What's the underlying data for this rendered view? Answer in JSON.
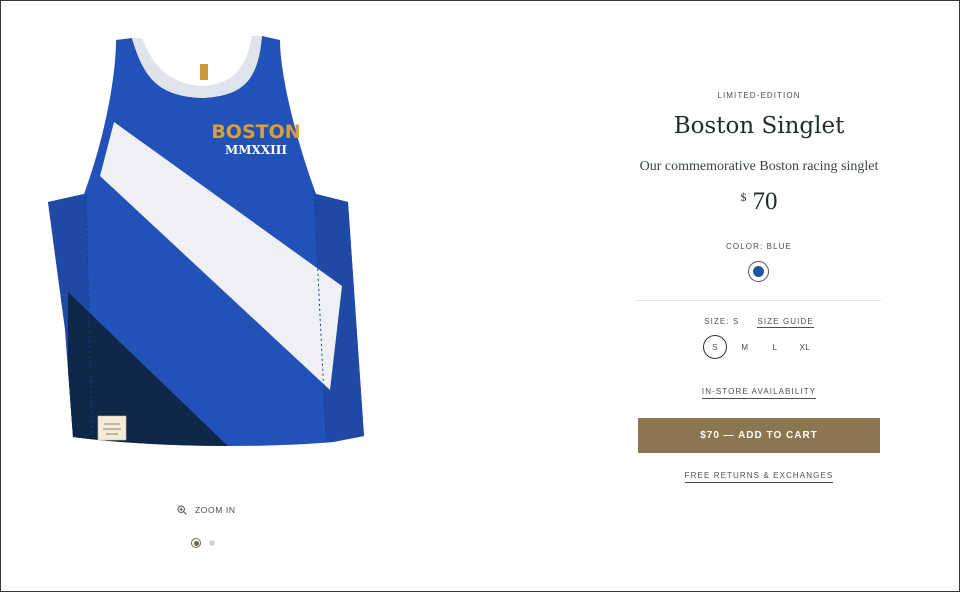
{
  "colors": {
    "accent": "#8b7651",
    "swatch_blue": "#1e56a0",
    "text": "#1e2d2b"
  },
  "gallery": {
    "image_alt": "Boston Singlet in blue",
    "print": {
      "line1": "BOSTON",
      "line2": "MMXXIII"
    },
    "zoom_icon": "zoom-in-icon",
    "zoom_label": "ZOOM IN",
    "slide_count": 2,
    "active_slide": 1
  },
  "product": {
    "eyebrow": "LIMITED-EDITION",
    "title": "Boston Singlet",
    "subtitle": "Our commemorative Boston racing singlet",
    "currency": "$",
    "price": "70",
    "color_label": "COLOR: BLUE",
    "size_label": "SIZE: S",
    "size_guide": "SIZE GUIDE",
    "sizes": [
      "S",
      "M",
      "L",
      "XL"
    ],
    "selected_size": "S",
    "instore": "IN-STORE AVAILABILITY",
    "add_to_cart": "$70 — ADD TO CART",
    "returns": "FREE RETURNS & EXCHANGES"
  }
}
